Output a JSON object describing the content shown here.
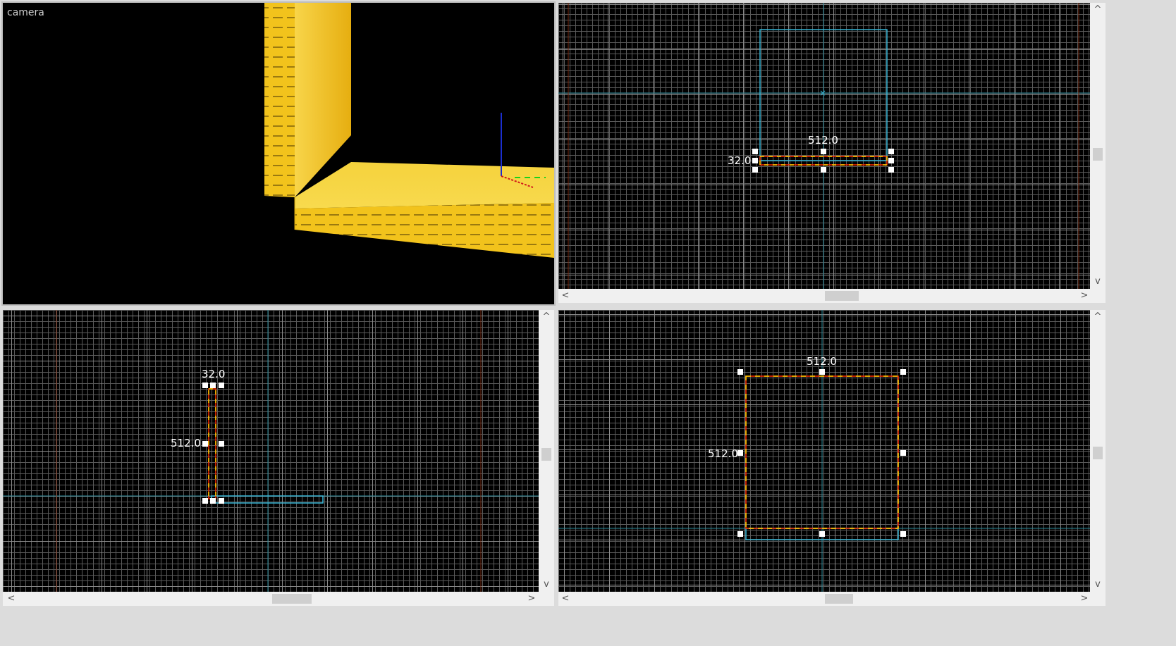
{
  "camera_view": {
    "label": "camera"
  },
  "top_right_view": {
    "width_label": "512.0",
    "height_label": "32.0"
  },
  "bottom_left_view": {
    "width_label": "32.0",
    "height_label": "512.0"
  },
  "bottom_right_view": {
    "width_label": "512.0",
    "height_label": "512.0"
  },
  "scroll_arrows": {
    "up": "^",
    "down": "v",
    "left": "<",
    "right": ">"
  },
  "colors": {
    "background": "#000000",
    "grid_minor": "#5a5a5a",
    "grid_major": "#8a8a8a",
    "axis_cyan": "#2a8a9a",
    "brush_yellow": "#f4c21a",
    "selection_red": "#ff2a00",
    "selection_dash": "#ffd400",
    "cyan_outline": "#37b6d6",
    "frame": "#bdbdbd"
  }
}
